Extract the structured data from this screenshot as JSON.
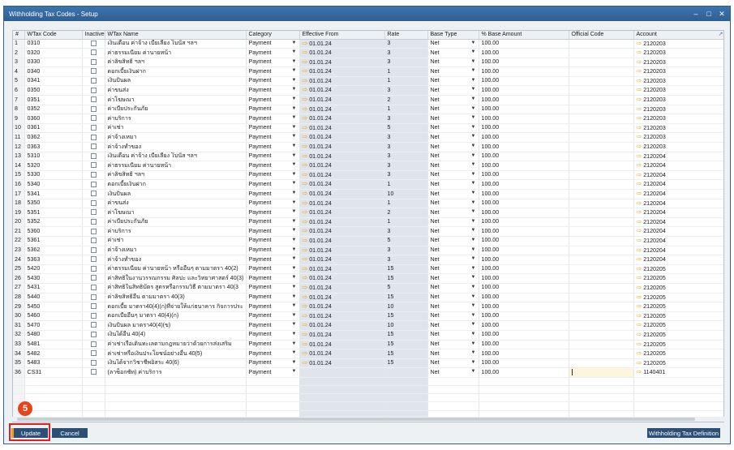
{
  "window": {
    "title": "Withholding Tax Codes - Setup",
    "min": "–",
    "max": "□",
    "close": "✕"
  },
  "columns": [
    "#",
    "WTax Code",
    "Inactive",
    "WTax Name",
    "Category",
    "Effective From",
    "Rate",
    "Base Type",
    "% Base Amount",
    "Official Code",
    "Account"
  ],
  "rows": [
    {
      "n": "1",
      "code": "0310",
      "name": "เงินเดือน ค่าจ้าง เบี้ยเลี้ยง โบนัส ฯลฯ",
      "cat": "Payment",
      "eff": "01.01.24",
      "rate": "3",
      "base": "Net",
      "pct": "100.00",
      "ofc": "",
      "acct": "2120203"
    },
    {
      "n": "2",
      "code": "0320",
      "name": "ค่าธรรมเนียม ค่านายหน้า",
      "cat": "Payment",
      "eff": "01.01.24",
      "rate": "3",
      "base": "Net",
      "pct": "100.00",
      "ofc": "",
      "acct": "2120203"
    },
    {
      "n": "3",
      "code": "0330",
      "name": "ค่าลิขสิทธิ์ ฯลฯ",
      "cat": "Payment",
      "eff": "01.01.24",
      "rate": "3",
      "base": "Net",
      "pct": "100.00",
      "ofc": "",
      "acct": "2120203"
    },
    {
      "n": "4",
      "code": "0340",
      "name": "ดอกเบี้ยเงินฝาก",
      "cat": "Payment",
      "eff": "01.01.24",
      "rate": "1",
      "base": "Net",
      "pct": "100.00",
      "ofc": "",
      "acct": "2120203"
    },
    {
      "n": "5",
      "code": "0341",
      "name": "เงินปันผล",
      "cat": "Payment",
      "eff": "01.01.24",
      "rate": "1",
      "base": "Net",
      "pct": "100.00",
      "ofc": "",
      "acct": "2120203"
    },
    {
      "n": "6",
      "code": "0350",
      "name": "ค่าขนส่ง",
      "cat": "Payment",
      "eff": "01.01.24",
      "rate": "3",
      "base": "Net",
      "pct": "100.00",
      "ofc": "",
      "acct": "2120203"
    },
    {
      "n": "7",
      "code": "0351",
      "name": "ค่าโฆษณา",
      "cat": "Payment",
      "eff": "01.01.24",
      "rate": "2",
      "base": "Net",
      "pct": "100.00",
      "ofc": "",
      "acct": "2120203"
    },
    {
      "n": "8",
      "code": "0352",
      "name": "ค่าเบี้ยประกันภัย",
      "cat": "Payment",
      "eff": "01.01.24",
      "rate": "1",
      "base": "Net",
      "pct": "100.00",
      "ofc": "",
      "acct": "2120203"
    },
    {
      "n": "9",
      "code": "0360",
      "name": "ค่าบริการ",
      "cat": "Payment",
      "eff": "01.01.24",
      "rate": "3",
      "base": "Net",
      "pct": "100.00",
      "ofc": "",
      "acct": "2120203"
    },
    {
      "n": "10",
      "code": "0361",
      "name": "ค่าเช่า",
      "cat": "Payment",
      "eff": "01.01.24",
      "rate": "5",
      "base": "Net",
      "pct": "100.00",
      "ofc": "",
      "acct": "2120203"
    },
    {
      "n": "11",
      "code": "0362",
      "name": "ค่าจ้างเหมา",
      "cat": "Payment",
      "eff": "01.01.24",
      "rate": "3",
      "base": "Net",
      "pct": "100.00",
      "ofc": "",
      "acct": "2120203"
    },
    {
      "n": "12",
      "code": "0363",
      "name": "ค่าจ้างทำของ",
      "cat": "Payment",
      "eff": "01.01.24",
      "rate": "3",
      "base": "Net",
      "pct": "100.00",
      "ofc": "",
      "acct": "2120203"
    },
    {
      "n": "13",
      "code": "5310",
      "name": "เงินเดือน ค่าจ้าง เบี้ยเลี้ยง โบนัส ฯลฯ",
      "cat": "Payment",
      "eff": "01.01.24",
      "rate": "3",
      "base": "Net",
      "pct": "100.00",
      "ofc": "",
      "acct": "2120204"
    },
    {
      "n": "14",
      "code": "5320",
      "name": "ค่าธรรมเนียม ค่านายหน้า",
      "cat": "Payment",
      "eff": "01.01.24",
      "rate": "3",
      "base": "Net",
      "pct": "100.00",
      "ofc": "",
      "acct": "2120204"
    },
    {
      "n": "15",
      "code": "5330",
      "name": "ค่าลิขสิทธิ์ ฯลฯ",
      "cat": "Payment",
      "eff": "01.01.24",
      "rate": "3",
      "base": "Net",
      "pct": "100.00",
      "ofc": "",
      "acct": "2120204"
    },
    {
      "n": "16",
      "code": "5340",
      "name": "ดอกเบี้ยเงินฝาก",
      "cat": "Payment",
      "eff": "01.01.24",
      "rate": "1",
      "base": "Net",
      "pct": "100.00",
      "ofc": "",
      "acct": "2120204"
    },
    {
      "n": "17",
      "code": "5341",
      "name": "เงินปันผล",
      "cat": "Payment",
      "eff": "01.01.24",
      "rate": "10",
      "base": "Net",
      "pct": "100.00",
      "ofc": "",
      "acct": "2120204"
    },
    {
      "n": "18",
      "code": "5350",
      "name": "ค่าขนส่ง",
      "cat": "Payment",
      "eff": "01.01.24",
      "rate": "1",
      "base": "Net",
      "pct": "100.00",
      "ofc": "",
      "acct": "2120204"
    },
    {
      "n": "19",
      "code": "5351",
      "name": "ค่าโฆษณา",
      "cat": "Payment",
      "eff": "01.01.24",
      "rate": "2",
      "base": "Net",
      "pct": "100.00",
      "ofc": "",
      "acct": "2120204"
    },
    {
      "n": "20",
      "code": "5352",
      "name": "ค่าเบี้ยประกันภัย",
      "cat": "Payment",
      "eff": "01.01.24",
      "rate": "1",
      "base": "Net",
      "pct": "100.00",
      "ofc": "",
      "acct": "2120204"
    },
    {
      "n": "21",
      "code": "5360",
      "name": "ค่าบริการ",
      "cat": "Payment",
      "eff": "01.01.24",
      "rate": "3",
      "base": "Net",
      "pct": "100.00",
      "ofc": "",
      "acct": "2120204"
    },
    {
      "n": "22",
      "code": "5361",
      "name": "ค่าเช่า",
      "cat": "Payment",
      "eff": "01.01.24",
      "rate": "5",
      "base": "Net",
      "pct": "100.00",
      "ofc": "",
      "acct": "2120204"
    },
    {
      "n": "23",
      "code": "5362",
      "name": "ค่าจ้างเหมา",
      "cat": "Payment",
      "eff": "01.01.24",
      "rate": "3",
      "base": "Net",
      "pct": "100.00",
      "ofc": "",
      "acct": "2120204"
    },
    {
      "n": "24",
      "code": "5363",
      "name": "ค่าจ้างทำของ",
      "cat": "Payment",
      "eff": "01.01.24",
      "rate": "3",
      "base": "Net",
      "pct": "100.00",
      "ofc": "",
      "acct": "2120204"
    },
    {
      "n": "25",
      "code": "5420",
      "name": "ค่าธรรมเนียม ค่านายหน้า หรืออื่นๆ ตามมาตรา 40(2)",
      "cat": "Payment",
      "eff": "01.01.24",
      "rate": "15",
      "base": "Net",
      "pct": "100.00",
      "ofc": "",
      "acct": "2120205"
    },
    {
      "n": "26",
      "code": "5430",
      "name": "ค่าสิทธิในงานวรรณกรรม ศิลปะ และวิทยาศาสตร์ 40(3)",
      "cat": "Payment",
      "eff": "01.01.24",
      "rate": "15",
      "base": "Net",
      "pct": "100.00",
      "ofc": "",
      "acct": "2120205"
    },
    {
      "n": "27",
      "code": "5431",
      "name": "ค่าสิทธิในสิทธิบัตร สูตรหรือกรรมวิธี ตามมาตรา 40(3",
      "cat": "Payment",
      "eff": "01.01.24",
      "rate": "5",
      "base": "Net",
      "pct": "100.00",
      "ofc": "",
      "acct": "2120205"
    },
    {
      "n": "28",
      "code": "5440",
      "name": "ค่าลิขสิทธิ์อื่น ตามมาตรา 40(3)",
      "cat": "Payment",
      "eff": "01.01.24",
      "rate": "15",
      "base": "Net",
      "pct": "100.00",
      "ofc": "",
      "acct": "2120205"
    },
    {
      "n": "29",
      "code": "5450",
      "name": "ดอกเบี้ย มาตรา40(4)(ก)ที่จ่ายให้แก่ธนาคาร กิจการประ",
      "cat": "Payment",
      "eff": "01.01.24",
      "rate": "10",
      "base": "Net",
      "pct": "100.00",
      "ofc": "",
      "acct": "2120205"
    },
    {
      "n": "30",
      "code": "5460",
      "name": "ดอกเบี้ยอื่นๆ มาตรา 40(4)(ก)",
      "cat": "Payment",
      "eff": "01.01.24",
      "rate": "15",
      "base": "Net",
      "pct": "100.00",
      "ofc": "",
      "acct": "2120205"
    },
    {
      "n": "31",
      "code": "5470",
      "name": "เงินปันผล มาตรา40(4)(ข)",
      "cat": "Payment",
      "eff": "01.01.24",
      "rate": "10",
      "base": "Net",
      "pct": "100.00",
      "ofc": "",
      "acct": "2120205"
    },
    {
      "n": "32",
      "code": "5480",
      "name": "เงินได้อื่น 40(4)",
      "cat": "Payment",
      "eff": "01.01.24",
      "rate": "15",
      "base": "Net",
      "pct": "100.00",
      "ofc": "",
      "acct": "2120205"
    },
    {
      "n": "33",
      "code": "5481",
      "name": "ค่าเช่าเรือเดินทะเลตามกฎหมายว่าด้วยการส่งเสริม",
      "cat": "Payment",
      "eff": "01.01.24",
      "rate": "15",
      "base": "Net",
      "pct": "100.00",
      "ofc": "",
      "acct": "2120205"
    },
    {
      "n": "34",
      "code": "5482",
      "name": "ค่าเช่าหรือเงินประโยชน์อย่างอื่น 40(5)",
      "cat": "Payment",
      "eff": "01.01.24",
      "rate": "15",
      "base": "Net",
      "pct": "100.00",
      "ofc": "",
      "acct": "2120205"
    },
    {
      "n": "35",
      "code": "5483",
      "name": "เงินได้จากวิชาชีพอิสระ 40(6)",
      "cat": "Payment",
      "eff": "01.01.24",
      "rate": "15",
      "base": "Net",
      "pct": "100.00",
      "ofc": "",
      "acct": "2120205"
    },
    {
      "n": "36",
      "code": "CS31",
      "name": "(ลาซ็อกซัท) ค่าบริการ",
      "cat": "Payment",
      "eff": "",
      "rate": "",
      "base": "Net",
      "pct": "100.00",
      "ofc": "",
      "acct": "1140401"
    }
  ],
  "badge": "5",
  "buttons": {
    "update": "Update",
    "cancel": "Cancel",
    "definition": "Withholding Tax Definition"
  },
  "colors": {
    "accent": "#e8a020",
    "title_bar": "#2e5f94",
    "button": "#2b4f77",
    "highlight": "#e02020"
  }
}
